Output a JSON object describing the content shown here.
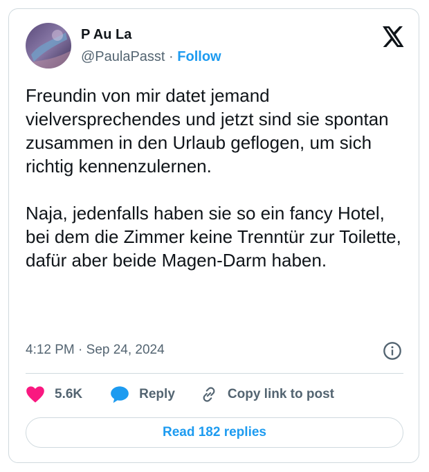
{
  "author": {
    "display_name": "P Au La",
    "handle": "@PaulaPasst",
    "separator": "·",
    "follow_label": "Follow"
  },
  "tweet": {
    "paragraph_1": "Freundin von mir datet jemand vielversprechendes und jetzt sind sie spontan zusammen in den Urlaub geflogen, um sich richtig kennenzulernen.",
    "paragraph_2": "Naja, jedenfalls haben sie so ein fancy Hotel, bei dem die Zimmer keine Trenntür zur Toilette, dafür aber beide Magen-Darm haben.",
    "timestamp": "4:12 PM · Sep 24, 2024"
  },
  "actions": {
    "likes": "5.6K",
    "reply_label": "Reply",
    "copy_label": "Copy link to post"
  },
  "footer": {
    "read_replies_label": "Read 182 replies"
  },
  "colors": {
    "accent": "#1d9bf0",
    "like": "#f91880",
    "muted": "#536471",
    "text": "#0f1419"
  },
  "icons": [
    "x-logo-icon",
    "info-icon",
    "heart-icon",
    "reply-bubble-icon",
    "link-icon"
  ]
}
